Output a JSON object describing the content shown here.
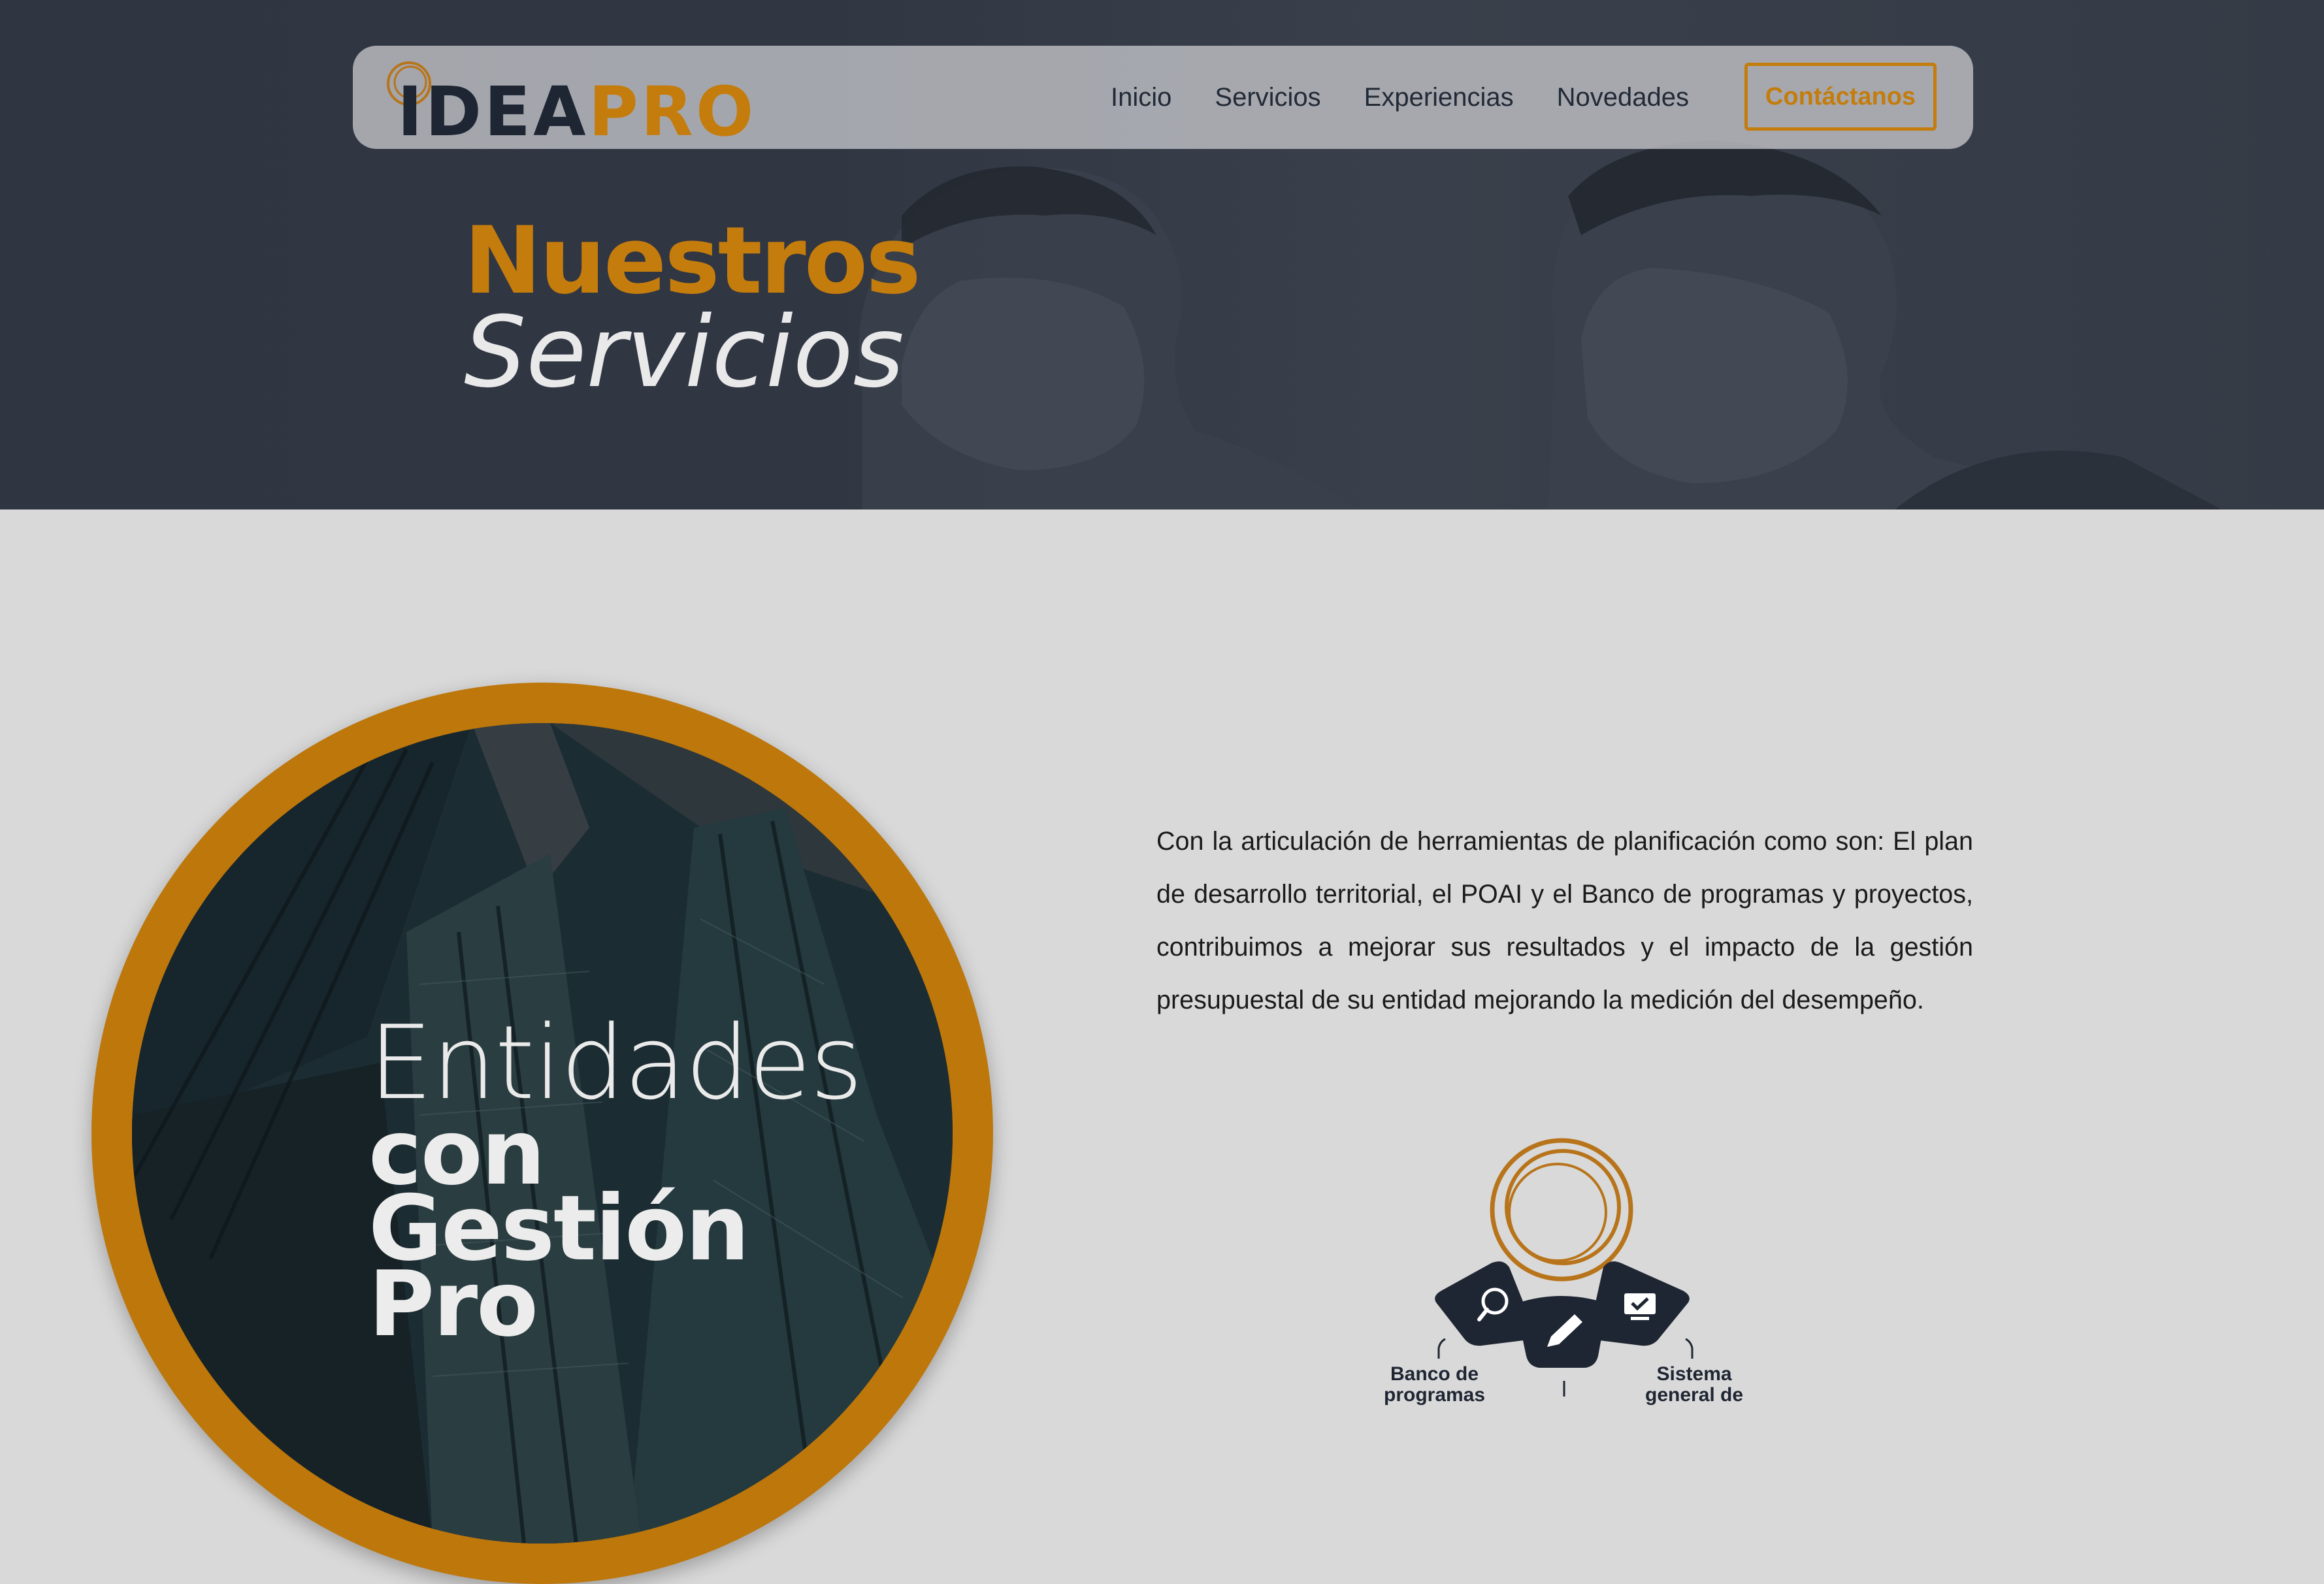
{
  "brand": {
    "name_part1": "IDEA",
    "name_part2": "PRO",
    "accent_color": "#c47c0c",
    "dark_color": "#1f2633"
  },
  "nav": {
    "items": [
      {
        "label": "Inicio"
      },
      {
        "label": "Servicios"
      },
      {
        "label": "Experiencias"
      },
      {
        "label": "Novedades"
      }
    ],
    "cta_label": "Contáctanos"
  },
  "hero": {
    "title_bold": "Nuestros",
    "title_light": "Servicios"
  },
  "feature": {
    "circle_line1": "Entidades",
    "circle_line2": "con",
    "circle_line3": "Gestión",
    "circle_line4": "Pro"
  },
  "intro": {
    "paragraph": "Con la articulación de herramientas de planificación como son: El plan de desarrollo territorial, el POAI y el Banco de programas y proyectos, contribuimos a mejorar sus resultados y el impacto de la gestión presupuestal de su entidad mejorando la medición del desempeño."
  },
  "diagram": {
    "left_label_1": "Banco de",
    "left_label_2": "programas",
    "right_label_1": "Sistema",
    "right_label_2": "general de",
    "icons": [
      "search-icon",
      "pencil-icon",
      "monitor-check-icon"
    ]
  }
}
